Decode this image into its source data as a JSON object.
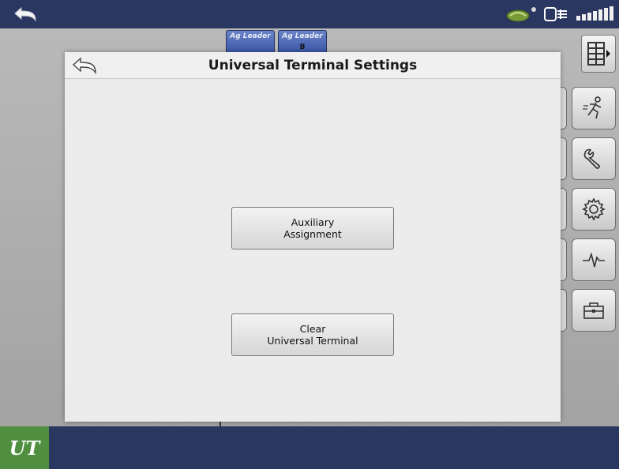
{
  "dialog": {
    "title": "Universal Terminal Settings",
    "buttons": {
      "auxiliary": {
        "line1": "Auxiliary",
        "line2": "Assignment"
      },
      "clear": {
        "line1": "Clear",
        "line2": "Universal Terminal"
      }
    }
  },
  "modules": [
    {
      "brand": "Ag Leader",
      "sub": ""
    },
    {
      "brand": "Ag Leader",
      "sub": "B"
    }
  ],
  "bottombar": {
    "ut_label": "UT"
  },
  "colors": {
    "topbar": "#2a3760",
    "ut_tile": "#4f8f3f",
    "module_tab": "#3a56a6"
  },
  "icons": {
    "top_back": "back-arrow-icon",
    "status": [
      "gps-satellite-icon",
      "display-connection-icon",
      "signal-strength-icon"
    ],
    "layout": "grid-layout-icon",
    "sidebar": [
      "operator-run-icon",
      "wrench-icon",
      "gear-icon",
      "diagnostics-pulse-icon",
      "toolbox-icon"
    ],
    "dialog_back": "back-arrow-icon"
  }
}
